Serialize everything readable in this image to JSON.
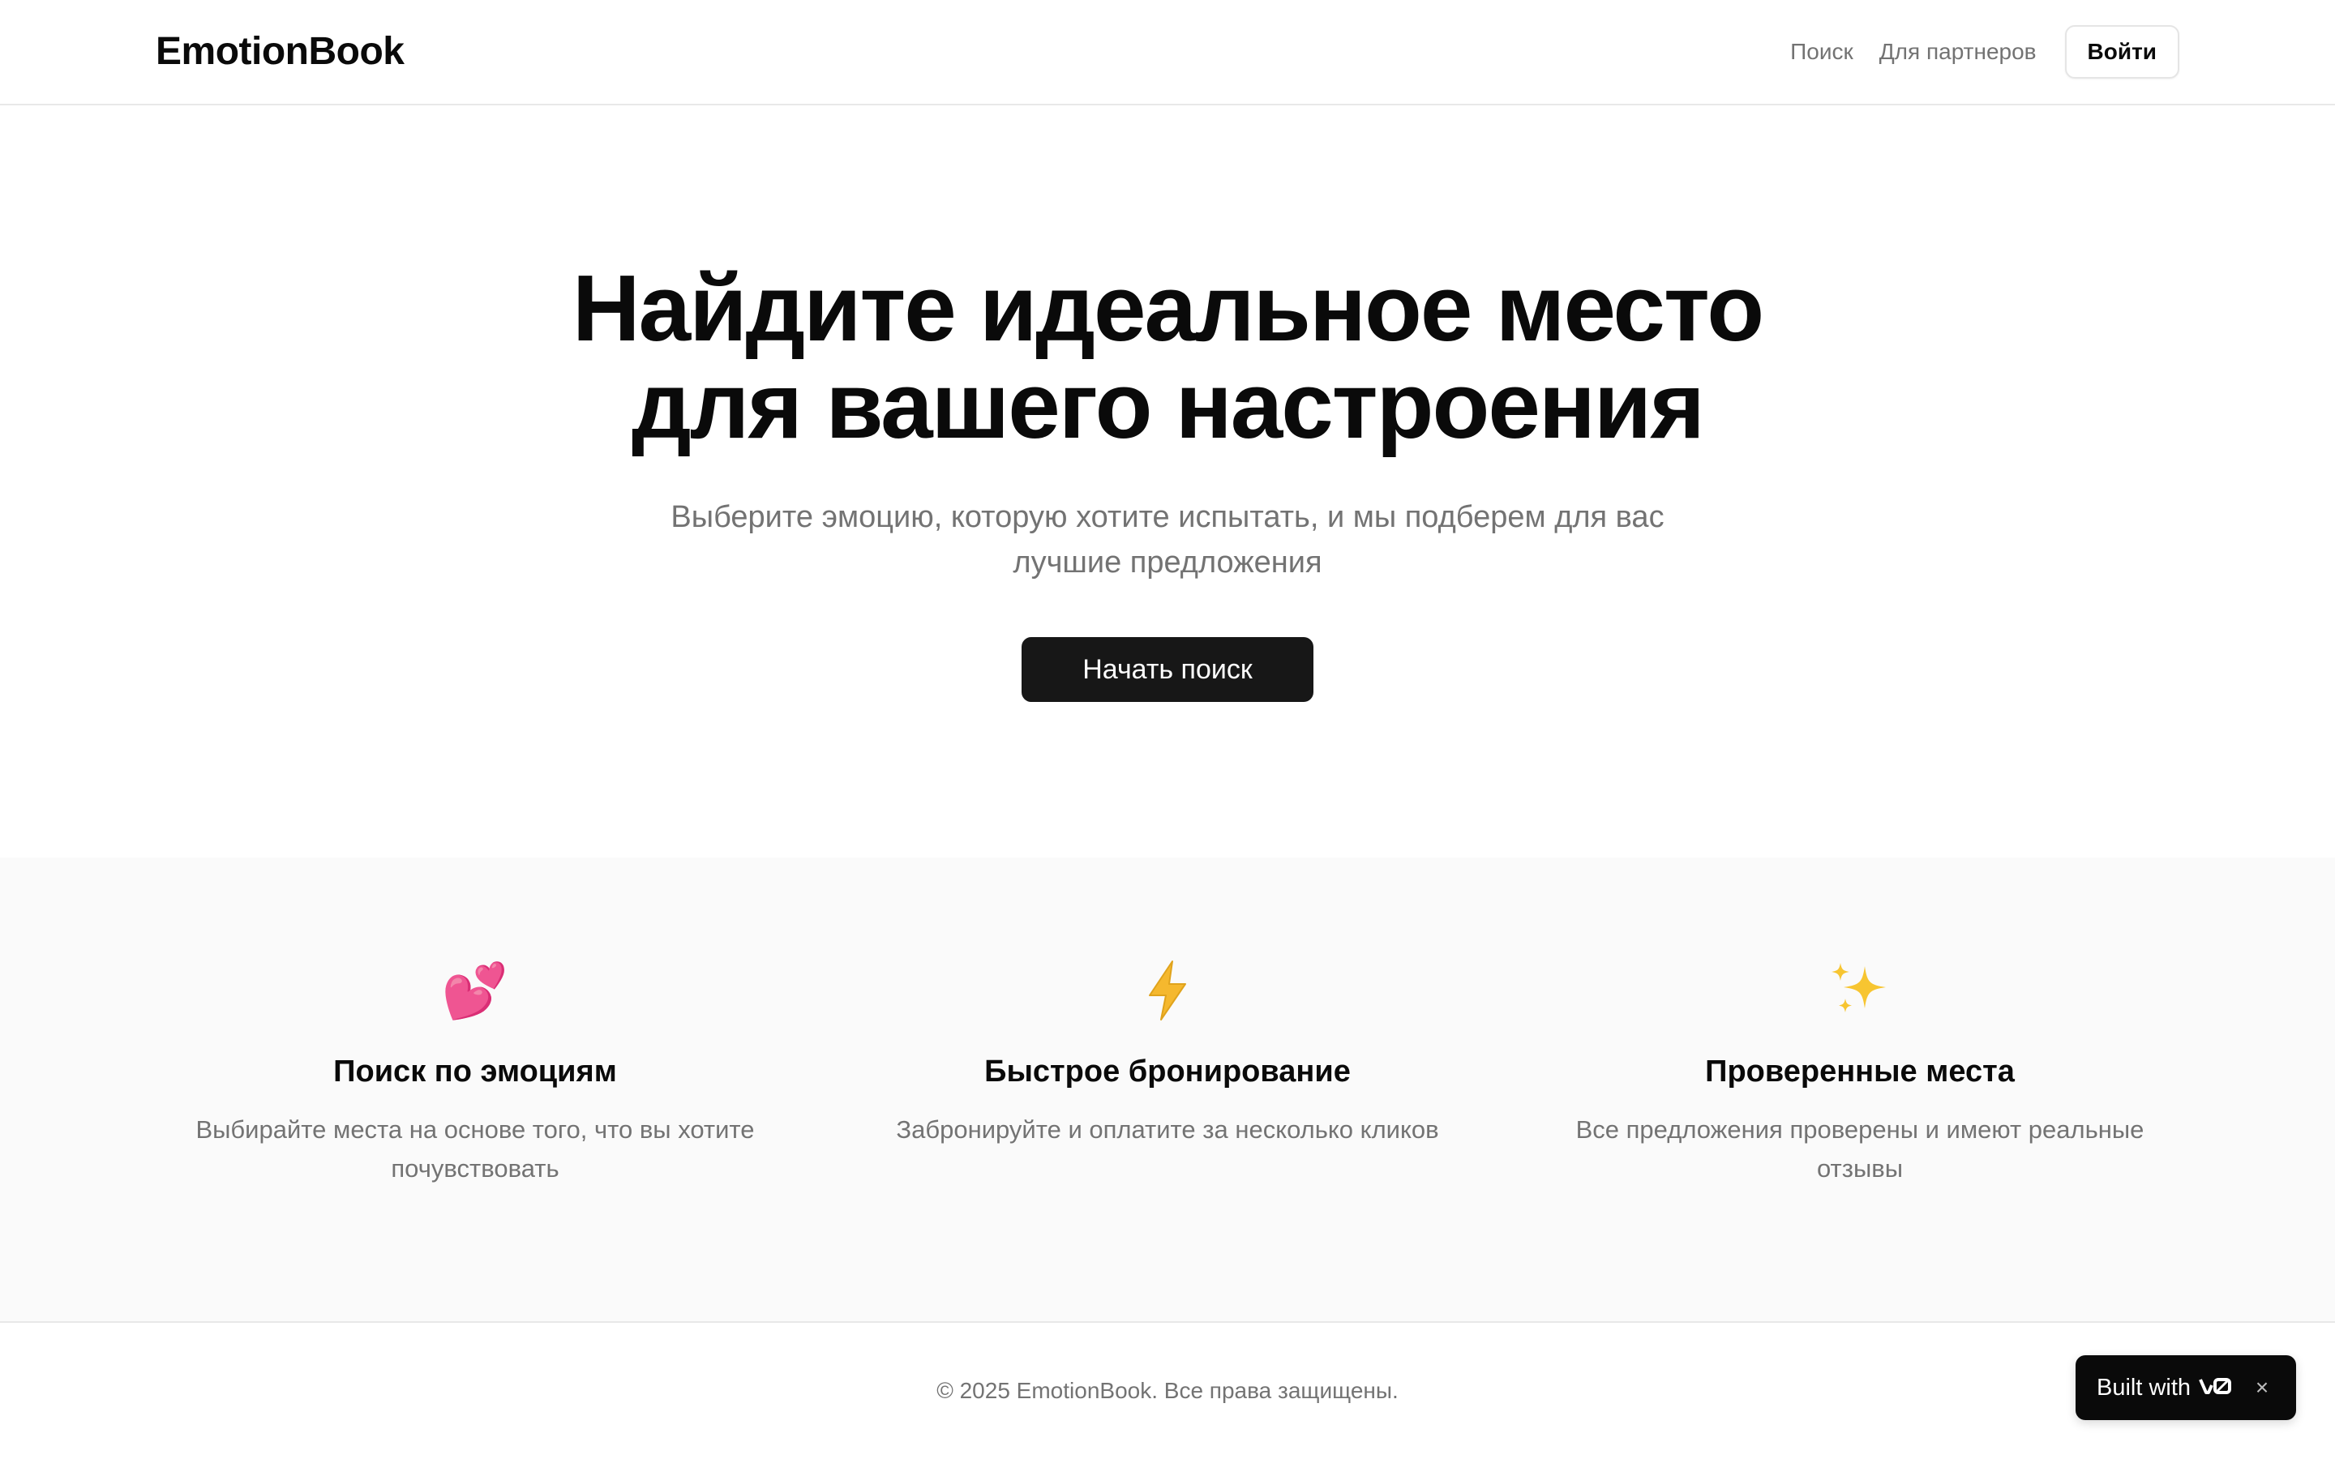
{
  "header": {
    "logo": "EmotionBook",
    "nav": {
      "search": "Поиск",
      "partners": "Для партнеров",
      "login": "Войти"
    }
  },
  "hero": {
    "title_line1": "Найдите идеальное место",
    "title_line2": "для вашего настроения",
    "subtitle_line1": "Выберите эмоцию, которую хотите испытать, и мы подберем для вас",
    "subtitle_line2": "лучшие предложения",
    "cta": "Начать поиск"
  },
  "features": [
    {
      "icon": "two-hearts-icon",
      "glyph": "💕",
      "title": "Поиск по эмоциям",
      "desc_line1": "Выбирайте места на основе того, что вы хотите",
      "desc_line2": "почувствовать"
    },
    {
      "icon": "lightning-icon",
      "glyph": "⚡",
      "title": "Быстрое бронирование",
      "desc_line1": "Забронируйте и оплатите за несколько кликов",
      "desc_line2": ""
    },
    {
      "icon": "sparkles-icon",
      "glyph": "✨",
      "title": "Проверенные места",
      "desc_line1": "Все предложения проверены и имеют реальные",
      "desc_line2": "отзывы"
    }
  ],
  "footer": {
    "copyright": "© 2025 EmotionBook. Все права защищены."
  },
  "badge": {
    "text": "Built with",
    "close": "×"
  },
  "colors": {
    "primary": "#171717",
    "muted_text": "#737373",
    "border": "#e8e8e8",
    "section_bg": "#fafafa",
    "lightning": "#f5b82e",
    "hearts": "#e8388a",
    "sparkles": "#f7c531"
  }
}
